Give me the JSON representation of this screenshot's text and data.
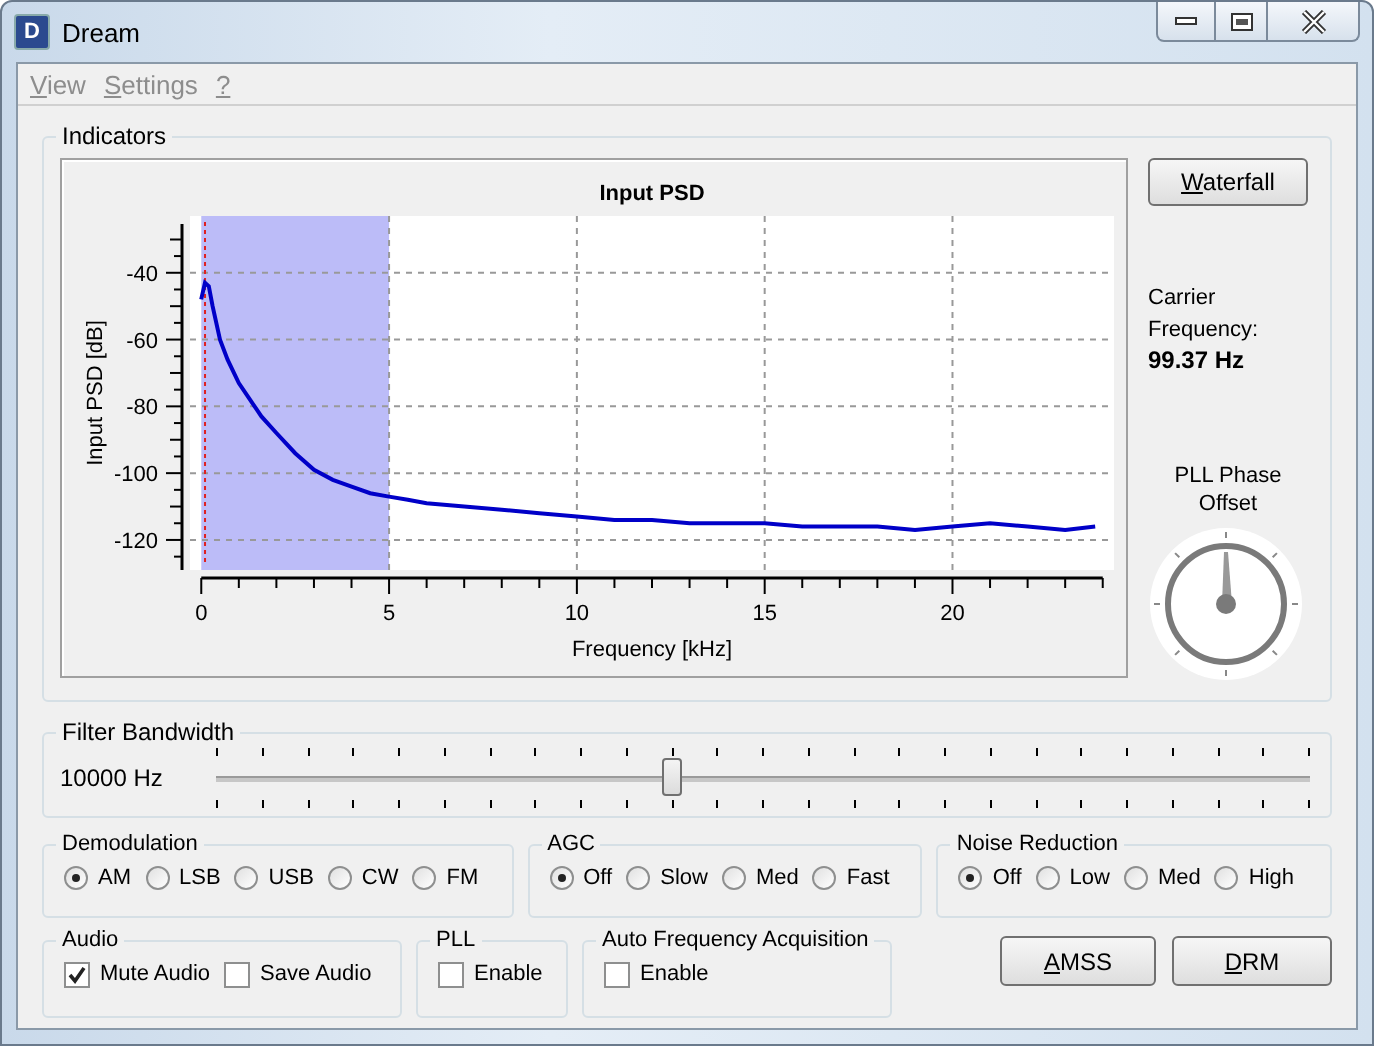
{
  "window": {
    "title": "Dream",
    "icon_text": "D"
  },
  "menu": [
    {
      "label": "View",
      "disabled": true
    },
    {
      "label": "Settings",
      "disabled": true
    },
    {
      "label": "?",
      "disabled": true
    }
  ],
  "indicators": {
    "title": "Indicators",
    "chart_data": {
      "type": "line",
      "title": "Input PSD",
      "xlabel": "Frequency [kHz]",
      "ylabel": "Input PSD [dB]",
      "x": [
        0,
        0.1,
        0.2,
        0.3,
        0.5,
        0.7,
        1,
        1.3,
        1.6,
        2,
        2.5,
        3,
        3.5,
        4,
        4.5,
        5,
        5.5,
        6,
        7,
        8,
        9,
        10,
        11,
        12,
        13,
        14,
        15,
        16,
        17,
        18,
        19,
        20,
        21,
        22,
        23,
        23.8
      ],
      "series": [
        {
          "color": "#0000c8",
          "values": [
            -48,
            -43,
            -44,
            -50,
            -60,
            -66,
            -73,
            -78,
            -83,
            -88,
            -94,
            -99,
            -102,
            -104,
            -106,
            -107,
            -108,
            -109,
            -110,
            -111,
            -112,
            -113,
            -114,
            -114,
            -115,
            -115,
            -115,
            -116,
            -116,
            -116,
            -117,
            -116,
            -115,
            -116,
            -117,
            -116
          ]
        }
      ],
      "xlim": [
        -0.3,
        24.3
      ],
      "ylim": [
        -129,
        -23
      ],
      "xticks": [
        0,
        5,
        10,
        15,
        20
      ],
      "yticks": [
        -40,
        -60,
        -80,
        -100,
        -120
      ],
      "grid": true,
      "bands": [
        {
          "axis": "x",
          "from": 0,
          "to": 5
        }
      ],
      "ref_lines": [
        {
          "axis": "x",
          "value": 0.1
        }
      ]
    },
    "waterfall_button": "Waterfall",
    "carrier_label": "Carrier Frequency:",
    "carrier_value": "99.37 Hz",
    "pll_label": "PLL Phase Offset"
  },
  "filter": {
    "title": "Filter Bandwidth",
    "value": "10000 Hz",
    "level": 0.417
  },
  "groups": [
    {
      "title": "Demodulation",
      "kind": "radio",
      "options": [
        {
          "label": "AM",
          "selected": true
        },
        {
          "label": "LSB",
          "selected": false
        },
        {
          "label": "USB",
          "selected": false
        },
        {
          "label": "CW",
          "selected": false
        },
        {
          "label": "FM",
          "selected": false
        }
      ]
    },
    {
      "title": "AGC",
      "kind": "radio",
      "options": [
        {
          "label": "Off",
          "selected": true
        },
        {
          "label": "Slow",
          "selected": false
        },
        {
          "label": "Med",
          "selected": false
        },
        {
          "label": "Fast",
          "selected": false
        }
      ]
    },
    {
      "title": "Noise Reduction",
      "kind": "radio",
      "options": [
        {
          "label": "Off",
          "selected": true
        },
        {
          "label": "Low",
          "selected": false
        },
        {
          "label": "Med",
          "selected": false
        },
        {
          "label": "High",
          "selected": false
        }
      ]
    },
    {
      "title": "Audio",
      "kind": "check",
      "options": [
        {
          "label": "Mute Audio",
          "checked": true
        },
        {
          "label": "Save Audio",
          "checked": false
        }
      ]
    },
    {
      "title": "PLL",
      "kind": "check",
      "options": [
        {
          "label": "Enable",
          "checked": false
        }
      ]
    },
    {
      "title": "Auto Frequency Acquisition",
      "kind": "check",
      "options": [
        {
          "label": "Enable",
          "checked": false
        }
      ]
    }
  ],
  "buttons": [
    "AMSS",
    "DRM"
  ]
}
